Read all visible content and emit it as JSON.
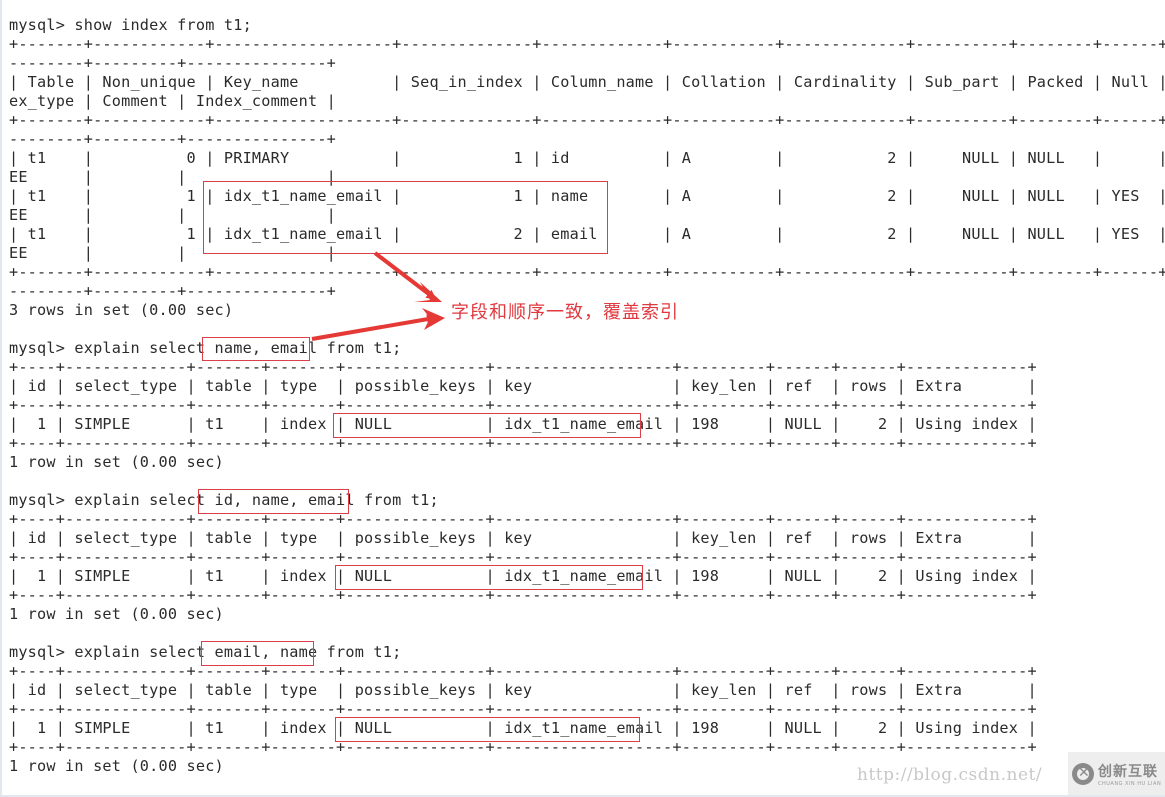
{
  "terminal": {
    "lines": [
      "mysql> show index from t1;",
      "+-------+------------+-------------------+--------------+-------------+-----------+-------------+----------+--------+------+----",
      "--------+---------+---------------+",
      "| Table | Non_unique | Key_name          | Seq_in_index | Column_name | Collation | Cardinality | Sub_part | Packed | Null | Ind",
      "ex_type | Comment | Index_comment |",
      "+-------+------------+-------------------+--------------+-------------+-----------+-------------+----------+--------+------+----",
      "--------+---------+---------------+",
      "| t1    |          0 | PRIMARY           |            1 | id          | A         |           2 |     NULL | NULL   |      | BTR",
      "EE      |         |               |",
      "| t1    |          1 | idx_t1_name_email |            1 | name        | A         |           2 |     NULL | NULL   | YES  | BTR",
      "EE      |         |               |",
      "| t1    |          1 | idx_t1_name_email |            2 | email       | A         |           2 |     NULL | NULL   | YES  | BTR",
      "EE      |         |               |",
      "+-------+------------+-------------------+--------------+-------------+-----------+-------------+----------+--------+------+----",
      "--------+---------+---------------+",
      "3 rows in set (0.00 sec)",
      "",
      "mysql> explain select name, email from t1;",
      "+----+-------------+-------+-------+---------------+-------------------+---------+------+------+-------------+",
      "| id | select_type | table | type  | possible_keys | key               | key_len | ref  | rows | Extra       |",
      "+----+-------------+-------+-------+---------------+-------------------+---------+------+------+-------------+",
      "|  1 | SIMPLE      | t1    | index | NULL          | idx_t1_name_email | 198     | NULL |    2 | Using index |",
      "+----+-------------+-------+-------+---------------+-------------------+---------+------+------+-------------+",
      "1 row in set (0.00 sec)",
      "",
      "mysql> explain select id, name, email from t1;",
      "+----+-------------+-------+-------+---------------+-------------------+---------+------+------+-------------+",
      "| id | select_type | table | type  | possible_keys | key               | key_len | ref  | rows | Extra       |",
      "+----+-------------+-------+-------+---------------+-------------------+---------+------+------+-------------+",
      "|  1 | SIMPLE      | t1    | index | NULL          | idx_t1_name_email | 198     | NULL |    2 | Using index |",
      "+----+-------------+-------+-------+---------------+-------------------+---------+------+------+-------------+",
      "1 row in set (0.00 sec)",
      "",
      "mysql> explain select email, name from t1;",
      "+----+-------------+-------+-------+---------------+-------------------+---------+------+------+-------------+",
      "| id | select_type | table | type  | possible_keys | key               | key_len | ref  | rows | Extra       |",
      "+----+-------------+-------+-------+---------------+-------------------+---------+------+------+-------------+",
      "|  1 | SIMPLE      | t1    | index | NULL          | idx_t1_name_email | 198     | NULL |    2 | Using index |",
      "+----+-------------+-------+-------+---------------+-------------------+---------+------+------+-------------+",
      "1 row in set (0.00 sec)"
    ]
  },
  "queries": [
    {
      "command": "show index from t1;",
      "columns": [
        "Table",
        "Non_unique",
        "Key_name",
        "Seq_in_index",
        "Column_name",
        "Collation",
        "Cardinality",
        "Sub_part",
        "Packed",
        "Null",
        "Index_type",
        "Comment",
        "Index_comment"
      ],
      "rows": [
        [
          "t1",
          "0",
          "PRIMARY",
          "1",
          "id",
          "A",
          "2",
          "NULL",
          "NULL",
          "",
          "BTREE",
          "",
          ""
        ],
        [
          "t1",
          "1",
          "idx_t1_name_email",
          "1",
          "name",
          "A",
          "2",
          "NULL",
          "NULL",
          "YES",
          "BTREE",
          "",
          ""
        ],
        [
          "t1",
          "1",
          "idx_t1_name_email",
          "2",
          "email",
          "A",
          "2",
          "NULL",
          "NULL",
          "YES",
          "BTREE",
          "",
          ""
        ]
      ],
      "footer": "3 rows in set (0.00 sec)"
    },
    {
      "command": "explain select name, email from t1;",
      "highlight": "name, email",
      "columns": [
        "id",
        "select_type",
        "table",
        "type",
        "possible_keys",
        "key",
        "key_len",
        "ref",
        "rows",
        "Extra"
      ],
      "rows": [
        [
          "1",
          "SIMPLE",
          "t1",
          "index",
          "NULL",
          "idx_t1_name_email",
          "198",
          "NULL",
          "2",
          "Using index"
        ]
      ],
      "footer": "1 row in set (0.00 sec)"
    },
    {
      "command": "explain select id, name, email from t1;",
      "highlight": "id, name, email",
      "columns": [
        "id",
        "select_type",
        "table",
        "type",
        "possible_keys",
        "key",
        "key_len",
        "ref",
        "rows",
        "Extra"
      ],
      "rows": [
        [
          "1",
          "SIMPLE",
          "t1",
          "index",
          "NULL",
          "idx_t1_name_email",
          "198",
          "NULL",
          "2",
          "Using index"
        ]
      ],
      "footer": "1 row in set (0.00 sec)"
    },
    {
      "command": "explain select email, name from t1;",
      "highlight": "email, name",
      "columns": [
        "id",
        "select_type",
        "table",
        "type",
        "possible_keys",
        "key",
        "key_len",
        "ref",
        "rows",
        "Extra"
      ],
      "rows": [
        [
          "1",
          "SIMPLE",
          "t1",
          "index",
          "NULL",
          "idx_t1_name_email",
          "198",
          "NULL",
          "2",
          "Using index"
        ]
      ],
      "footer": "1 row in set (0.00 sec)"
    }
  ],
  "annotation": {
    "note": "字段和顺序一致，覆盖索引",
    "color": "#e0393f"
  },
  "watermark": {
    "url": "http://blog.csdn.net/",
    "brand_cn": "创新互联",
    "brand_en": "CHUANG XIN HU LIAN"
  }
}
